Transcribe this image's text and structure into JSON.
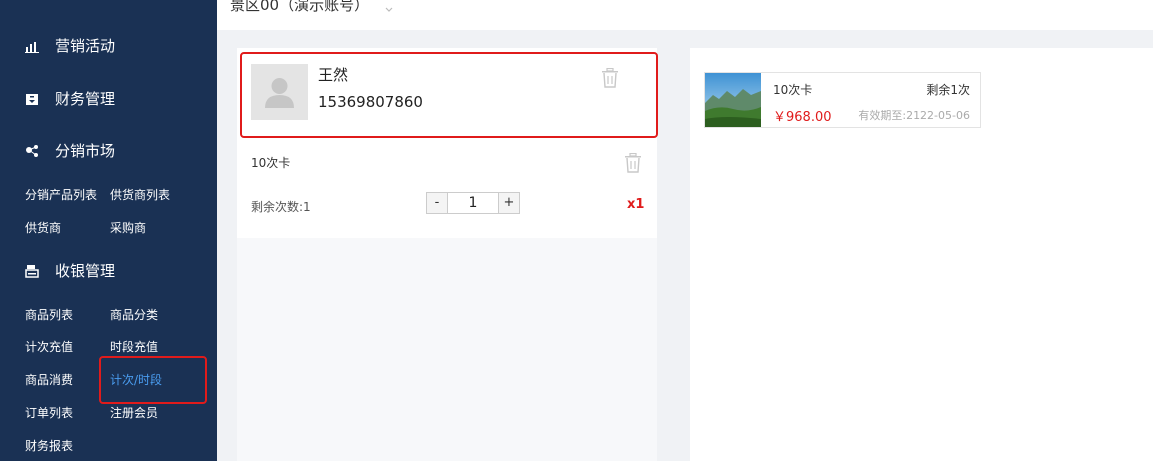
{
  "colors": {
    "sidebar_bg": "#1a3154",
    "active_link": "#4a9df0",
    "highlight_border": "#e01b1b",
    "price": "#e01b1b"
  },
  "header": {
    "venue": "景区00（演示账号）",
    "venue_icon": "chevron-down-icon"
  },
  "sidebar": {
    "sections": [
      {
        "label": "营销活动",
        "icon": "bar-chart-icon"
      },
      {
        "label": "财务管理",
        "icon": "wallet-icon"
      },
      {
        "label": "分销市场",
        "icon": "share-nodes-icon"
      },
      {
        "label": "收银管理",
        "icon": "cash-register-icon"
      }
    ],
    "distribution_items": [
      "分销产品列表",
      "供货商列表",
      "供货商",
      "采购商"
    ],
    "cashier_items": [
      "商品列表",
      "商品分类",
      "计次充值",
      "时段充值",
      "商品消费",
      "计次/时段",
      "订单列表",
      "注册会员",
      "财务报表"
    ],
    "active_item": "计次/时段"
  },
  "member": {
    "name": "王然",
    "phone": "15369807860",
    "avatar_icon": "user-avatar-icon",
    "delete_icon": "trash-icon"
  },
  "selected_card": {
    "title": "10次卡",
    "remaining_label": "剩余次数:1",
    "quantity": "1",
    "minus_label": "-",
    "plus_label": "+",
    "multiplier": "x1",
    "delete_icon": "trash-icon"
  },
  "products": [
    {
      "name": "10次卡",
      "remaining": "剩余1次",
      "price": "￥968.00",
      "expiry": "有效期至:2122-05-06",
      "thumb_icon": "landscape-image"
    }
  ]
}
